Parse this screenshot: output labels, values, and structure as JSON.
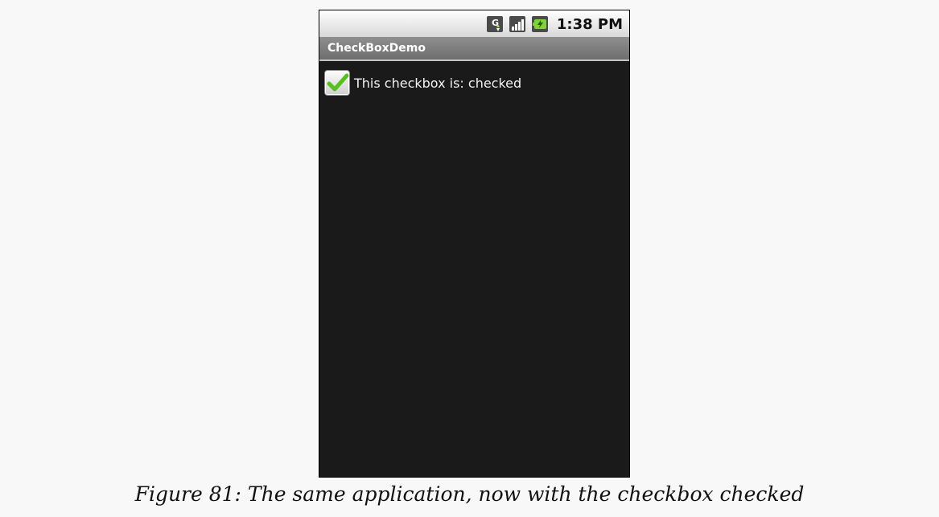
{
  "status_bar": {
    "icons": [
      "network-type-icon",
      "signal-strength-icon",
      "battery-icon"
    ],
    "network_type_letter": "G",
    "time": "1:38 PM"
  },
  "app": {
    "title": "CheckBoxDemo"
  },
  "checkbox": {
    "label": "This checkbox is: checked",
    "checked": true,
    "check_color": "#55c21c"
  },
  "caption": {
    "text": "Figure 81: The same application, now with the checkbox checked"
  }
}
